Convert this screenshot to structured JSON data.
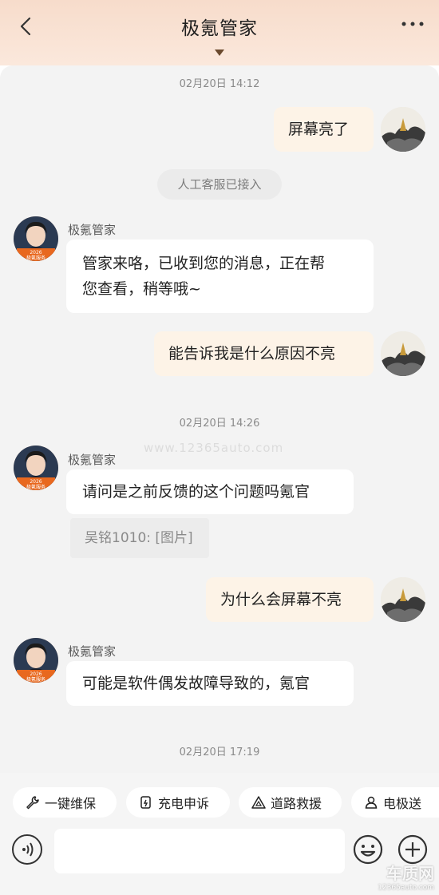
{
  "header": {
    "title": "极氪管家",
    "back_icon": "chevron-left-icon",
    "more_icon": "more-dots-icon"
  },
  "messages": {
    "time1": "02月20日 14:12",
    "user1": "屏幕亮了",
    "system_notice": "人工客服已接入",
    "agent_name": "极氪管家",
    "agent1_line1": "管家来咯，已收到您的消息，正在帮",
    "agent1_line2": "您查看，稍等哦~",
    "user2": "能告诉我是什么原因不亮",
    "time2": "02月20日 14:26",
    "agent2": "请问是之前反馈的这个问题吗氪官",
    "quote": "吴铭1010: [图片]",
    "user3": "为什么会屏幕不亮",
    "agent3": "可能是软件偶发故障导致的，氪官",
    "time3": "02月20日 17:19"
  },
  "avatar": {
    "badge_year": "2026",
    "badge_text": "极氪服务"
  },
  "watermark": "www.12365auto.com",
  "quick_actions": [
    {
      "label": "一键维保",
      "icon": "wrench-icon"
    },
    {
      "label": "充电申诉",
      "icon": "charge-doc-icon"
    },
    {
      "label": "道路救援",
      "icon": "warning-triangle-icon"
    },
    {
      "label": "电极送",
      "icon": "person-icon"
    }
  ],
  "input": {
    "voice_icon": "voice-icon",
    "emoji_icon": "emoji-icon",
    "plus_icon": "plus-icon"
  },
  "site_logo": {
    "text": "车质网",
    "url_text": "12365auto.com"
  },
  "colors": {
    "header_bg": "#f7dccb",
    "user_bubble": "#fdf3e7",
    "agent_bubble": "#ffffff",
    "badge_orange": "#e8681f"
  }
}
